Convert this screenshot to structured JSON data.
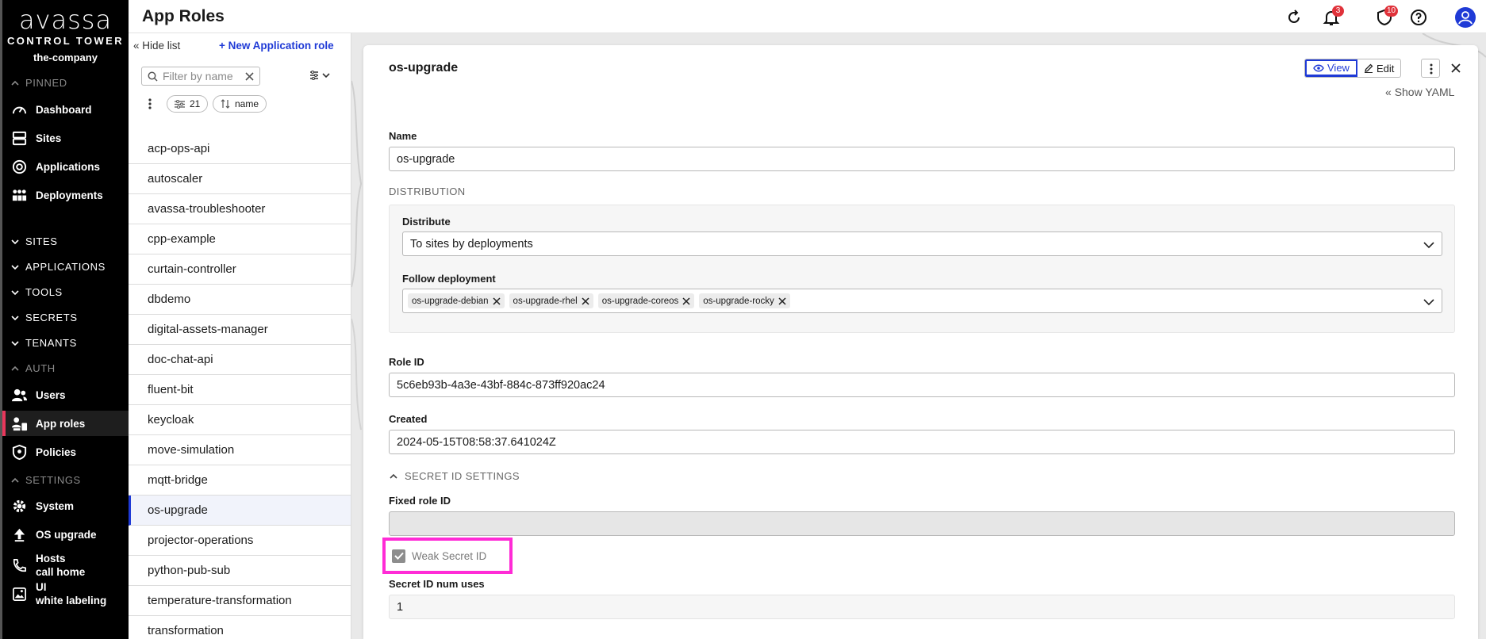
{
  "brand": {
    "logo": "avassa",
    "tagline": "CONTROL TOWER",
    "company": "the-company"
  },
  "sidebar": {
    "pinned": "PINNED",
    "pinned_items": [
      "Dashboard",
      "Sites",
      "Applications",
      "Deployments"
    ],
    "groups": [
      "SITES",
      "APPLICATIONS",
      "TOOLS",
      "SECRETS",
      "TENANTS"
    ],
    "auth": "AUTH",
    "auth_items": [
      "Users",
      "App roles",
      "Policies"
    ],
    "settings": "SETTINGS",
    "settings_items": [
      "System",
      "OS upgrade"
    ],
    "hosts_line1": "Hosts",
    "hosts_line2": "call home",
    "ui_line1": "UI",
    "ui_line2": "white labeling",
    "active": "App roles",
    "accent": "#e8375b"
  },
  "header": {
    "title": "App Roles",
    "notifications_count": "3",
    "alerts_count": "10"
  },
  "list": {
    "hide_label": "Hide list",
    "new_label": "New Application role",
    "filter_placeholder": "Filter by name",
    "filter_count": "21",
    "sort_label": "name",
    "items": [
      "acp-ops-api",
      "autoscaler",
      "avassa-troubleshooter",
      "cpp-example",
      "curtain-controller",
      "dbdemo",
      "digital-assets-manager",
      "doc-chat-api",
      "fluent-bit",
      "keycloak",
      "move-simulation",
      "mqtt-bridge",
      "os-upgrade",
      "projector-operations",
      "python-pub-sub",
      "temperature-transformation",
      "transformation"
    ],
    "selected": "os-upgrade"
  },
  "detail": {
    "title": "os-upgrade",
    "view_label": "View",
    "edit_label": "Edit",
    "show_yaml": "Show YAML",
    "name_label": "Name",
    "name_value": "os-upgrade",
    "distribution_section": "DISTRIBUTION",
    "distribute_label": "Distribute",
    "distribute_value": "To sites by deployments",
    "follow_label": "Follow deployment",
    "follow_tags": [
      "os-upgrade-debian",
      "os-upgrade-rhel",
      "os-upgrade-coreos",
      "os-upgrade-rocky"
    ],
    "role_id_label": "Role ID",
    "role_id_value": "5c6eb93b-4a3e-43bf-884c-873ff920ac24",
    "created_label": "Created",
    "created_value": "2024-05-15T08:58:37.641024Z",
    "secret_section": "SECRET ID SETTINGS",
    "fixed_role_label": "Fixed role ID",
    "fixed_role_value": "",
    "weak_secret_label": "Weak Secret ID",
    "weak_secret_checked": true,
    "num_uses_label": "Secret ID num uses",
    "num_uses_value": "1",
    "accent": "#1f3ad6",
    "highlight": "#ff2bd6"
  }
}
